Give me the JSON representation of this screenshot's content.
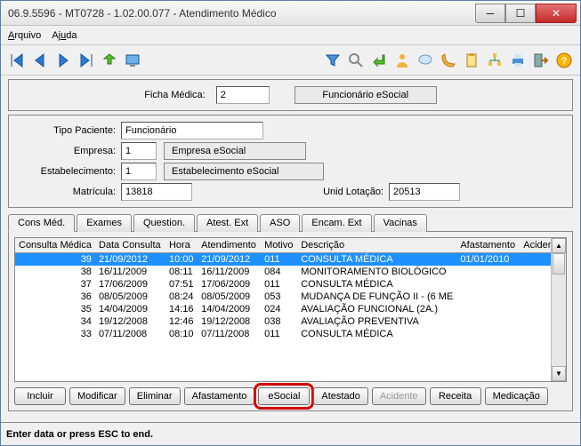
{
  "window": {
    "title": "06.9.5596 - MT0728 - 1.02.00.077 - Atendimento Médico"
  },
  "menu": {
    "arquivo": "Arquivo",
    "ajuda": "Ajuda"
  },
  "ficha": {
    "label": "Ficha Médica:",
    "value": "2",
    "funcionario_btn": "Funcionário eSocial"
  },
  "paciente": {
    "tipo_label": "Tipo Paciente:",
    "tipo_value": "Funcionário",
    "empresa_label": "Empresa:",
    "empresa_value": "1",
    "empresa_desc": "Empresa eSocial",
    "estab_label": "Estabelecimento:",
    "estab_value": "1",
    "estab_desc": "Estabelecimento eSocial",
    "matricula_label": "Matrícula:",
    "matricula_value": "13818",
    "unid_label": "Unid Lotação:",
    "unid_value": "20513"
  },
  "tabs": {
    "cons": "Cons Méd.",
    "exames": "Exames",
    "question": "Question.",
    "atestext": "Atest. Ext",
    "aso": "ASO",
    "encamext": "Encam. Ext",
    "vacinas": "Vacinas"
  },
  "columns": {
    "consulta": "Consulta Médica",
    "data": "Data Consulta",
    "hora": "Hora",
    "atend": "Atendimento",
    "motivo": "Motivo",
    "descricao": "Descrição",
    "afast": "Afastamento",
    "acid": "Acidente"
  },
  "rows": [
    {
      "id": "39",
      "data": "21/09/2012",
      "hora": "10:00",
      "atend": "21/09/2012",
      "motivo": "011",
      "desc": "CONSULTA MÉDICA",
      "afast": "01/01/2010",
      "acid": ""
    },
    {
      "id": "38",
      "data": "16/11/2009",
      "hora": "08:11",
      "atend": "16/11/2009",
      "motivo": "084",
      "desc": "MONITORAMENTO BIOLÓGICO",
      "afast": "",
      "acid": ""
    },
    {
      "id": "37",
      "data": "17/06/2009",
      "hora": "07:51",
      "atend": "17/06/2009",
      "motivo": "011",
      "desc": "CONSULTA MÉDICA",
      "afast": "",
      "acid": ""
    },
    {
      "id": "36",
      "data": "08/05/2009",
      "hora": "08:24",
      "atend": "08/05/2009",
      "motivo": "053",
      "desc": "MUDANÇA DE FUNÇÃO II - (6 ME",
      "afast": "",
      "acid": ""
    },
    {
      "id": "35",
      "data": "14/04/2009",
      "hora": "14:16",
      "atend": "14/04/2009",
      "motivo": "024",
      "desc": "AVALIAÇÃO FUNCIONAL (2A.)",
      "afast": "",
      "acid": ""
    },
    {
      "id": "34",
      "data": "19/12/2008",
      "hora": "12:46",
      "atend": "19/12/2008",
      "motivo": "038",
      "desc": "AVALIAÇÃO PREVENTIVA",
      "afast": "",
      "acid": ""
    },
    {
      "id": "33",
      "data": "07/11/2008",
      "hora": "08:10",
      "atend": "07/11/2008",
      "motivo": "011",
      "desc": "CONSULTA MÉDICA",
      "afast": "",
      "acid": ""
    }
  ],
  "buttons": {
    "incluir": "Incluir",
    "modificar": "Modificar",
    "eliminar": "Eliminar",
    "afast": "Afastamento",
    "esocial": "eSocial",
    "atestado": "Atestado",
    "acidente": "Acidente",
    "receita": "Receita",
    "medicacao": "Medicação"
  },
  "status": "Enter data or press ESC to end."
}
